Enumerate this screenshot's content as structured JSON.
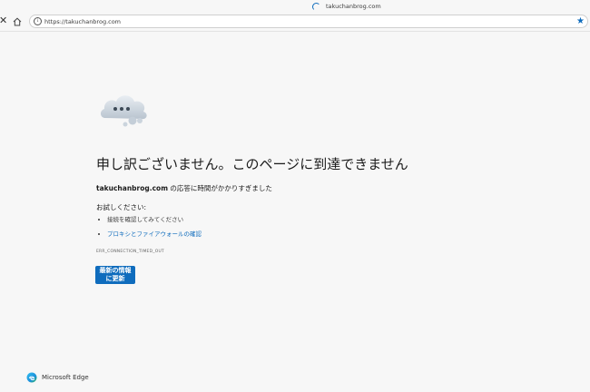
{
  "browser": {
    "tab_title": "takuchanbrog.com",
    "url": "https://takuchanbrog.com",
    "close_glyph": "✕",
    "star_glyph": "★",
    "info_glyph": "i",
    "icons": {
      "close": "close-icon",
      "home": "home-icon",
      "info": "info-icon",
      "favorite": "star-icon",
      "loading": "loading-spinner-icon"
    },
    "accent_color": "#0f6cbd"
  },
  "error": {
    "title": "申し訳ございません。このページに到達できません",
    "domain": "takuchanbrog.com",
    "message": " の応答に時間がかかりすぎました",
    "try_heading": "お試しください:",
    "suggestions": [
      {
        "text": "接続を確認してみてください",
        "is_link": false
      },
      {
        "text": "プロキシとファイアウォールの確認",
        "is_link": true
      }
    ],
    "code": "ERR_CONNECTION_TIMED_OUT",
    "refresh_button": "最新の情報に更新"
  },
  "footer": {
    "brand": "Microsoft Edge"
  }
}
